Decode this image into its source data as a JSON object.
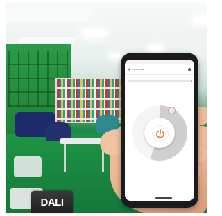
{
  "badge": {
    "label": "DALI"
  },
  "app": {
    "title": "Stand-alone"
  },
  "colors": {
    "accent": "#e07b2a",
    "badge_bg": "#222222",
    "room_green": "#1f8a4a"
  },
  "icons": {
    "power": "power-icon",
    "back": "back-arrow-icon",
    "menu": "menu-icon"
  }
}
